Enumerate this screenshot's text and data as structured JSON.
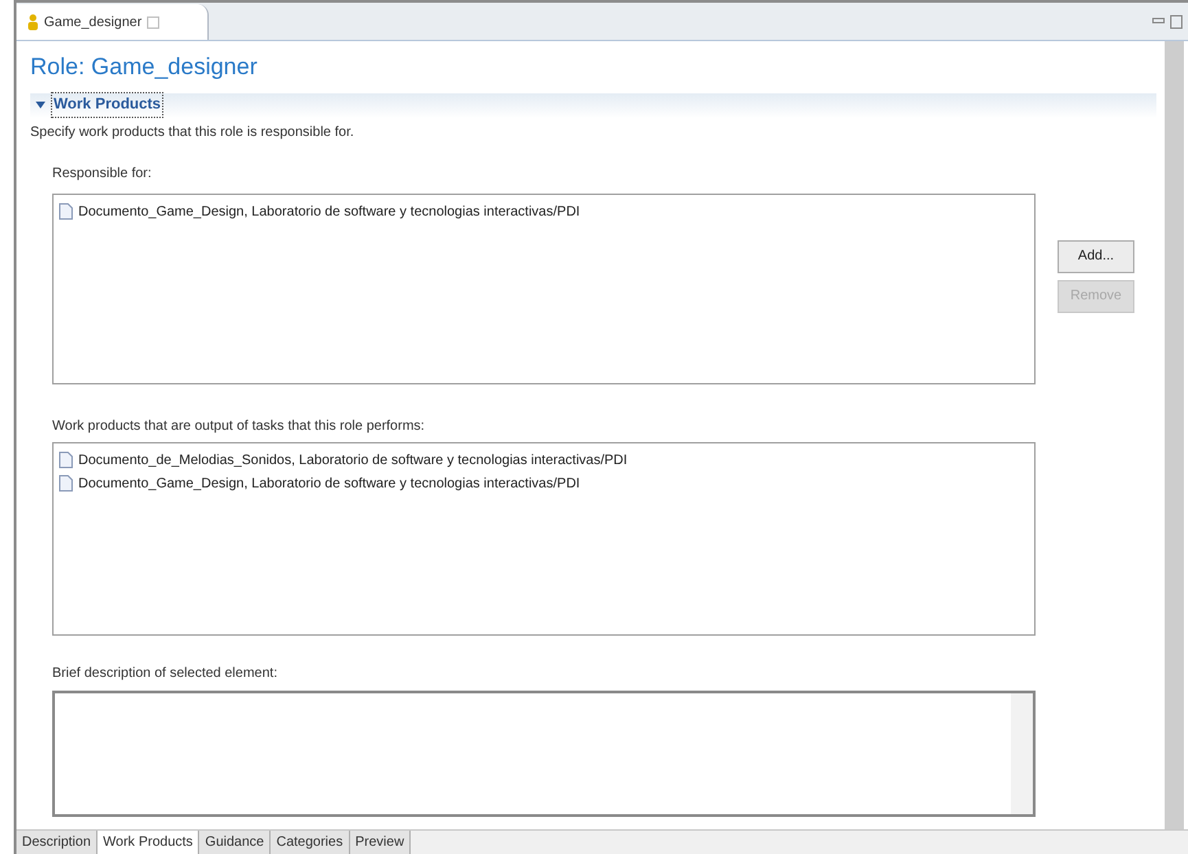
{
  "editor_tab": {
    "title": "Game_designer"
  },
  "heading": "Role: Game_designer",
  "section": {
    "title": "Work Products",
    "expanded": true,
    "description": "Specify work products that this role is responsible for."
  },
  "responsible_for": {
    "label": "Responsible for:",
    "items": [
      {
        "text": "Documento_Game_Design, Laboratorio de software y tecnologias interactivas/PDI"
      }
    ]
  },
  "buttons": [
    {
      "label": "Add...",
      "disabled": false
    },
    {
      "label": "Remove",
      "disabled": true
    }
  ],
  "output_products": {
    "label": "Work products that are output of tasks that this role performs:",
    "items": [
      {
        "text": "Documento_de_Melodias_Sonidos, Laboratorio de software y tecnologias interactivas/PDI"
      },
      {
        "text": "Documento_Game_Design, Laboratorio de software y tecnologias interactivas/PDI"
      }
    ]
  },
  "brief_description": {
    "label": "Brief description of selected element:"
  },
  "bottom_tabs": [
    {
      "label": "Description",
      "selected": false
    },
    {
      "label": "Work Products",
      "selected": true
    },
    {
      "label": "Guidance",
      "selected": false
    },
    {
      "label": "Categories",
      "selected": false
    },
    {
      "label": "Preview",
      "selected": false
    }
  ]
}
